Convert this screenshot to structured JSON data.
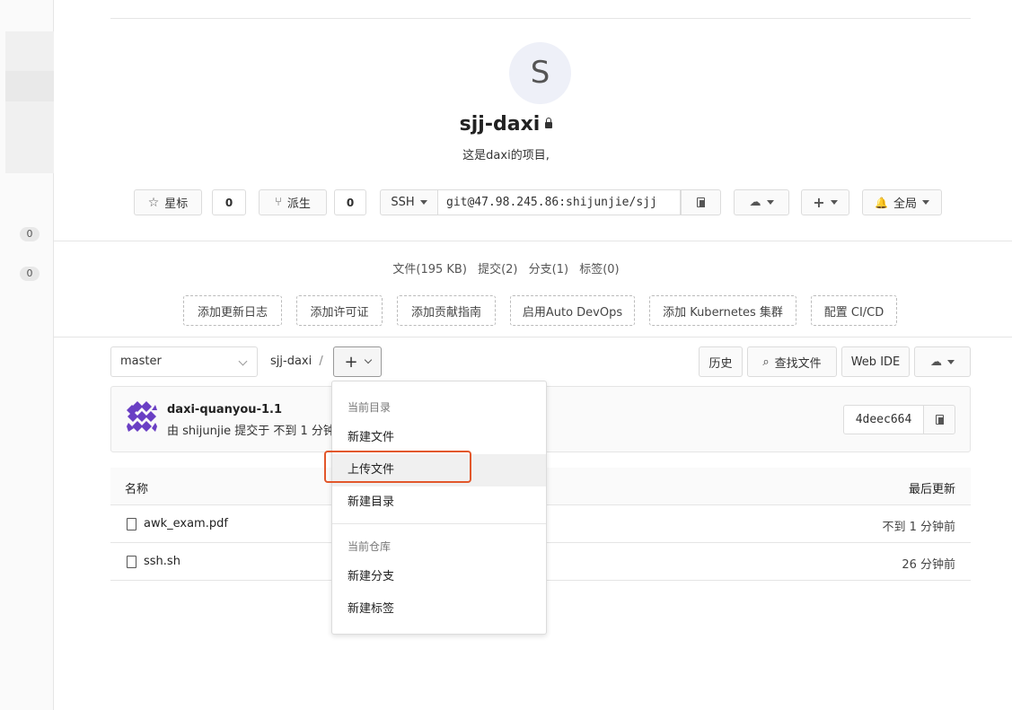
{
  "sidebar": {
    "counts": [
      "0",
      "0"
    ]
  },
  "project": {
    "avatar_letter": "S",
    "name": "sjj-daxi",
    "description": "这是daxi的项目,"
  },
  "actions": {
    "star_label": "星标",
    "star_count": "0",
    "fork_label": "派生",
    "fork_count": "0",
    "protocol": "SSH",
    "clone_url": "git@47.98.245.86:shijunjie/sjj",
    "notify_label": "全局"
  },
  "stats": {
    "files": "文件(195 KB)",
    "commits": "提交(2)",
    "branches": "分支(1)",
    "tags": "标签(0)"
  },
  "quick_actions": [
    "添加更新日志",
    "添加许可证",
    "添加贡献指南",
    "启用Auto DevOps",
    "添加 Kubernetes 集群",
    "配置 CI/CD"
  ],
  "browser": {
    "branch": "master",
    "breadcrumb": "sjj-daxi",
    "separator": "/",
    "plus": "+",
    "history_label": "历史",
    "find_file_label": "查找文件",
    "web_ide_label": "Web IDE"
  },
  "commit": {
    "title": "daxi-quanyou-1.1",
    "subtitle": "由 shijunjie 提交于 不到 1 分钟前",
    "sha": "4deec664"
  },
  "table": {
    "col_name": "名称",
    "col_updated": "最后更新",
    "rows": [
      {
        "name": "awk_exam.pdf",
        "updated": "不到 1 分钟前"
      },
      {
        "name": "ssh.sh",
        "updated": "26 分钟前"
      }
    ]
  },
  "dropdown": {
    "section1": "当前目录",
    "new_file": "新建文件",
    "upload_file": "上传文件",
    "new_dir": "新建目录",
    "section2": "当前仓库",
    "new_branch": "新建分支",
    "new_tag": "新建标签"
  },
  "colors": {
    "highlight": "#e2572b",
    "identicon": "#6a3fc4"
  }
}
